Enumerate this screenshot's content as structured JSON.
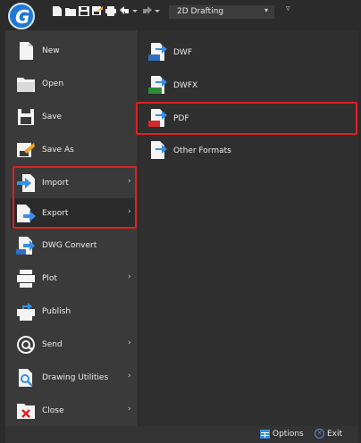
{
  "quick_access": {
    "workspace_value": "2D Drafting",
    "icons": [
      "logo-icon",
      "new-icon",
      "open-icon",
      "save-icon",
      "save-as-icon",
      "plot-icon",
      "undo-icon",
      "redo-icon"
    ]
  },
  "menu": {
    "items": [
      {
        "label": "New",
        "icon": "new-file-icon"
      },
      {
        "label": "Open",
        "icon": "open-folder-icon"
      },
      {
        "label": "Save",
        "icon": "save-icon"
      },
      {
        "label": "Save As",
        "icon": "save-as-icon"
      },
      {
        "label": "Import",
        "icon": "import-icon",
        "submenu": true
      },
      {
        "label": "Export",
        "icon": "export-icon",
        "submenu": true
      },
      {
        "label": "DWG Convert",
        "icon": "dwg-convert-icon"
      },
      {
        "label": "Plot",
        "icon": "plot-icon",
        "submenu": true
      },
      {
        "label": "Publish",
        "icon": "publish-icon"
      },
      {
        "label": "Send",
        "icon": "send-icon",
        "submenu": true
      },
      {
        "label": "Drawing Utilities",
        "icon": "drawing-utilities-icon",
        "submenu": true
      },
      {
        "label": "Close",
        "icon": "close-file-icon",
        "submenu": true
      }
    ],
    "submenu_arrow": "›"
  },
  "export_submenu": {
    "items": [
      {
        "label": "DWF",
        "icon": "dwf-icon"
      },
      {
        "label": "DWFX",
        "icon": "dwfx-icon"
      },
      {
        "label": "PDF",
        "icon": "pdf-icon"
      },
      {
        "label": "Other Formats",
        "icon": "other-formats-icon"
      }
    ]
  },
  "footer": {
    "options_label": "Options",
    "exit_label": "Exit"
  },
  "colors": {
    "highlight": "#e02020",
    "accent_blue": "#3a8ee6",
    "panel": "#3a3a3a"
  }
}
